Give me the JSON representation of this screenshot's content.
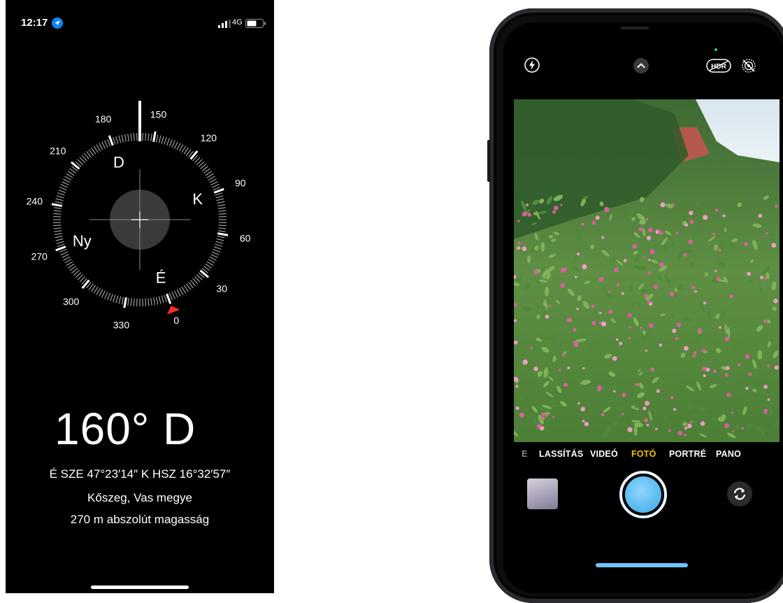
{
  "compass_app": {
    "status_bar": {
      "time": "12:17",
      "location_icon": "location-arrow-icon",
      "network": "4G",
      "signal_icon": "cellular-signal-icon",
      "battery_icon": "battery-icon"
    },
    "dial": {
      "degree_labels": [
        "0",
        "30",
        "60",
        "90",
        "120",
        "150",
        "180",
        "210",
        "240",
        "270",
        "300",
        "330"
      ],
      "cardinal_labels": {
        "north": "É",
        "east": "K",
        "south": "D",
        "west": "Ny"
      },
      "heading_degrees": 160,
      "marker_color": "#ff2d21"
    },
    "heading_text": "160° D",
    "coordinates": "É SZE 47°23′14″  K HSZ 16°32′57″",
    "place": "Kőszeg, Vas megye",
    "altitude": "270 m abszolút magasság"
  },
  "camera_app": {
    "top_icons": [
      "flash-icon",
      "chevron-up-icon",
      "hdr-icon",
      "live-photo-off-icon"
    ],
    "hdr_label": "HDR",
    "modes": {
      "partial": "E",
      "slowmo": "LASSÍTÁS",
      "video": "VIDEÓ",
      "photo": "FOTÓ",
      "portrait": "PORTRÉ",
      "pano": "PANO"
    },
    "active_mode": "FOTÓ",
    "active_color": "#f2c200",
    "shutter_color": "#5bbbef",
    "viewfinder_scene": "flower-bush-photo",
    "flip_icon": "camera-flip-icon"
  }
}
